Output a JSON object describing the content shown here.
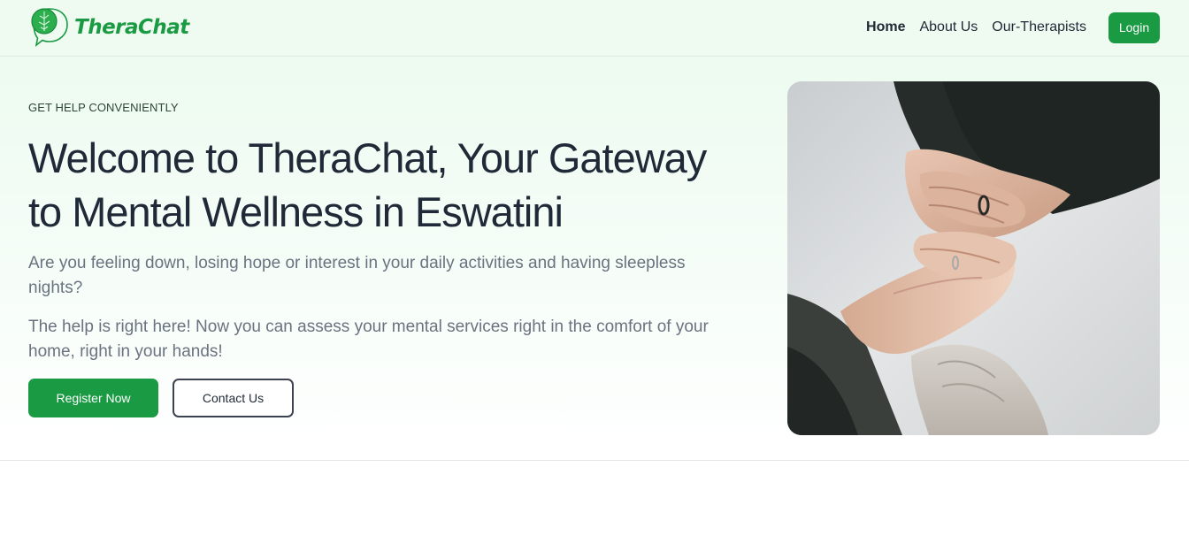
{
  "header": {
    "brand": "TheraChat",
    "nav": [
      {
        "label": "Home",
        "active": true
      },
      {
        "label": "About Us",
        "active": false
      },
      {
        "label": "Our-Therapists",
        "active": false
      }
    ],
    "login_label": "Login"
  },
  "hero": {
    "eyebrow": "GET HELP CONVENIENTLY",
    "headline": "Welcome to TheraChat, Your Gateway to Mental Wellness in Eswatini",
    "paragraph1": "Are you feeling down, losing hope or interest in your daily activities and having sleepless nights?",
    "paragraph2": "The help is right here! Now you can assess your mental services right in the comfort of your home, right in your hands!",
    "register_label": "Register Now",
    "contact_label": "Contact Us",
    "image_icon": "hands-holding-photo"
  },
  "colors": {
    "brand_green": "#1a9a43",
    "header_bg": "#effbf1",
    "headline": "#1f2937",
    "body_text": "#6b7280"
  }
}
